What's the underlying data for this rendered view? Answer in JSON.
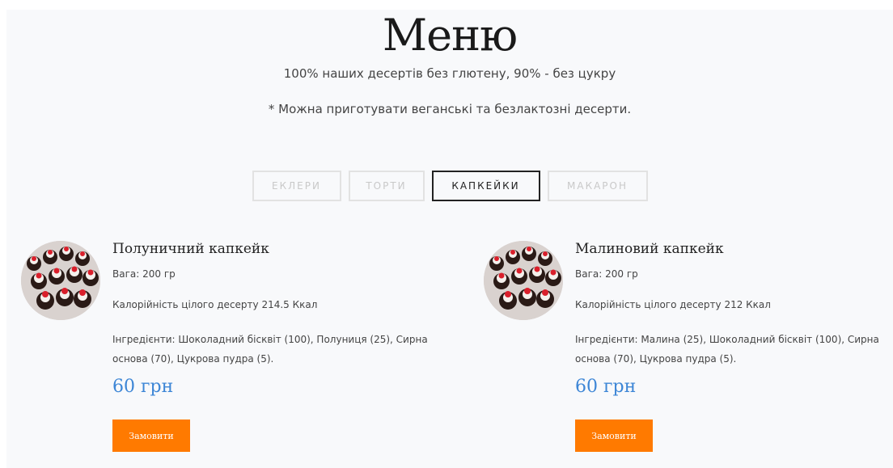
{
  "header": {
    "title": "Меню",
    "subtitle": "100% наших десертів без глютену, 90% - без цукру",
    "note": "* Можна приготувати веганські та безлактозні десерти."
  },
  "tabs": [
    {
      "label": "ЕКЛЕРИ",
      "active": false
    },
    {
      "label": "ТОРТИ",
      "active": false
    },
    {
      "label": "КАПКЕЙКИ",
      "active": true
    },
    {
      "label": "МАКАРОН",
      "active": false
    }
  ],
  "products": [
    {
      "name": "Полуничний капкейк",
      "weight": "Вага: 200 гр",
      "calories": "Калорійність цілого десерту 214.5 Ккал",
      "ingredients": "Інгредієнти: Шоколадний бісквіт (100), Полуниця (25), Сирна основа (70), Цукрова пудра (5).",
      "price": "60 грн",
      "order_label": "Замовити"
    },
    {
      "name": "Малиновий капкейк",
      "weight": "Вага: 200 гр",
      "calories": "Калорійність цілого десерту 212 Ккал",
      "ingredients": "Інгредієнти: Малина (25), Шоколадний бісквіт (100), Сирна основа (70), Цукрова пудра (5).",
      "price": "60 грн",
      "order_label": "Замовити"
    }
  ],
  "colors": {
    "accent_price": "#3d86d6",
    "order_button": "#ff7a00",
    "page_bg": "#f8f9fb"
  }
}
